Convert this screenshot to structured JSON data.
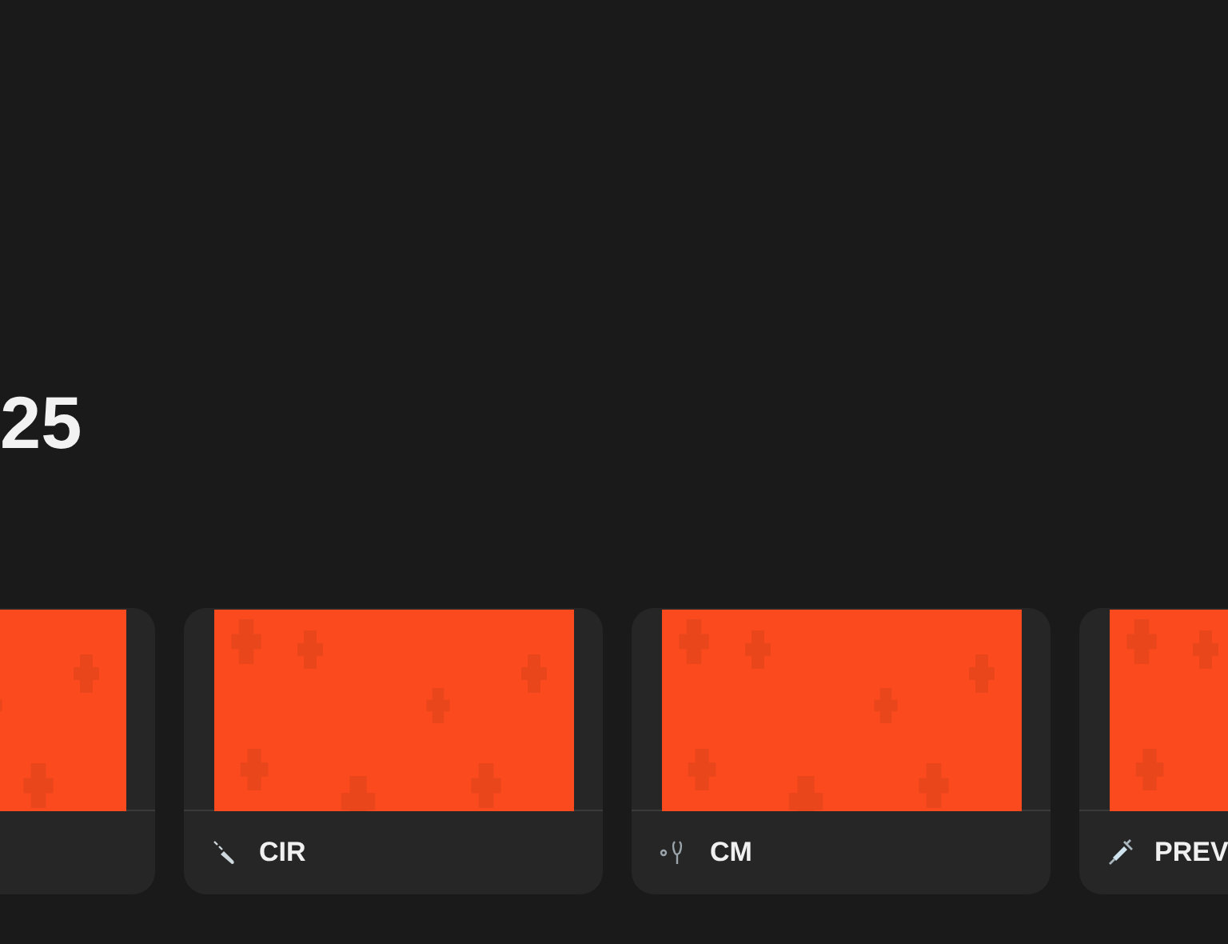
{
  "heading": "25",
  "cards": [
    {
      "kind": "blank"
    },
    {
      "kind": "scalpel",
      "label": "CIR"
    },
    {
      "kind": "stethoscope",
      "label": "CM"
    },
    {
      "kind": "syringe",
      "label": "PREV"
    }
  ]
}
